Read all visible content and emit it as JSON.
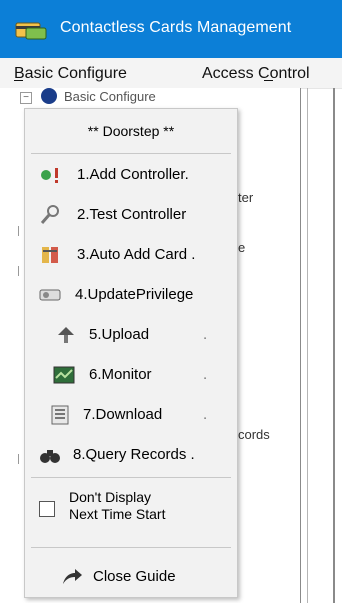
{
  "window": {
    "title": "Contactless Cards Management"
  },
  "menu": {
    "basic_configure": "Basic Configure",
    "access_control": "Access Control"
  },
  "background_tree": {
    "top_item": "Basic Configure",
    "frag_ter": "ter",
    "frag_e": "e",
    "frag_cords": "cords"
  },
  "guide": {
    "header": "** Doorstep **",
    "items": [
      {
        "label": "1.Add Controller.",
        "icon": "add-controller-icon"
      },
      {
        "label": "2.Test Controller",
        "icon": "test-controller-icon"
      },
      {
        "label": "3.Auto Add Card .",
        "icon": "auto-add-card-icon"
      },
      {
        "label": "4.UpdatePrivilege",
        "icon": "update-privilege-icon"
      },
      {
        "label": "5.Upload",
        "icon": "upload-icon"
      },
      {
        "label": "6.Monitor",
        "icon": "monitor-icon"
      },
      {
        "label": "7.Download",
        "icon": "download-icon"
      },
      {
        "label": "8.Query Records .",
        "icon": "query-records-icon"
      }
    ],
    "dont_display_line1": "Don't Display",
    "dont_display_line2": "Next Time Start",
    "dont_display_checked": false,
    "close_label": "Close Guide"
  },
  "colors": {
    "titlebar": "#0c7fd7",
    "panel": "#f2f2f2"
  }
}
